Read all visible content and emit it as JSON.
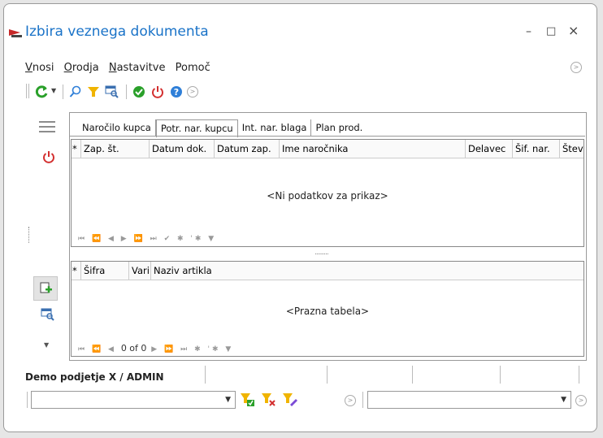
{
  "window": {
    "title": "Izbira veznega dokumenta",
    "minimize": "–",
    "maximize": "□",
    "close": "×"
  },
  "menu": {
    "items": [
      "Vnosi",
      "Orodja",
      "Nastavitve",
      "Pomoč"
    ],
    "underlined_first": [
      "V",
      "O",
      "N",
      ""
    ]
  },
  "tabs": [
    "Naročilo kupca",
    "Potr. nar. kupcu",
    "Int. nar. blaga",
    "Plan prod."
  ],
  "active_tab": 1,
  "top_grid": {
    "columns": [
      "*",
      "Zap. št.",
      "Datum dok.",
      "Datum zap.",
      "Ime naročnika",
      "Delavec",
      "Šif. nar.",
      "Štev"
    ],
    "empty_text": "<Ni podatkov za prikaz>",
    "navigator": "⏮ ⏪ ◀ ▶ ⏩ ⏭ ✔ ✱ '✱ ▼"
  },
  "bottom_grid": {
    "columns": [
      "*",
      "Šifra",
      "Vari",
      "Naziv artikla"
    ],
    "empty_text": "<Prazna tabela>",
    "navigator_record": "0 of 0"
  },
  "status": {
    "label": "Demo podjetje X / ADMIN"
  },
  "colors": {
    "title": "#1a73c8",
    "refresh": "#2aa02a",
    "power": "#d32f2f",
    "filter": "#f0b400",
    "help": "#2f7fd8"
  }
}
